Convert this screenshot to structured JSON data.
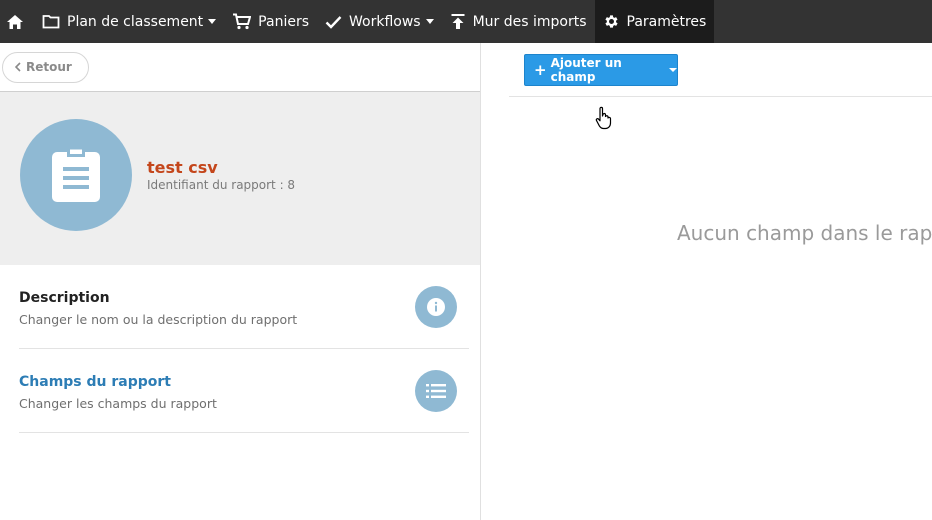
{
  "nav": {
    "home_icon": "home-icon",
    "items": [
      {
        "label": "Plan de classement",
        "icon": "folder-icon",
        "dropdown": true
      },
      {
        "label": "Paniers",
        "icon": "cart-icon",
        "dropdown": false
      },
      {
        "label": "Workflows",
        "icon": "check-icon",
        "dropdown": true
      },
      {
        "label": "Mur des imports",
        "icon": "upload-icon",
        "dropdown": false
      },
      {
        "label": "Paramètres",
        "icon": "gear-icon",
        "dropdown": false,
        "active": true
      }
    ]
  },
  "back": {
    "label": "Retour"
  },
  "report": {
    "title": "test csv",
    "subtitle": "Identifiant du rapport : 8",
    "icon": "clipboard-icon"
  },
  "menu": [
    {
      "title": "Description",
      "desc": "Changer le nom ou la description du rapport",
      "icon": "info-icon"
    },
    {
      "title": "Champs du rapport",
      "desc": "Changer les champs du rapport",
      "icon": "list-icon"
    }
  ],
  "toolbar": {
    "add_label": "Ajouter un champ"
  },
  "empty_message": "Aucun champ dans le rapport",
  "colors": {
    "nav_bg": "#333333",
    "accent_blue": "#2b9ae6",
    "title_orange": "#c4461b",
    "avatar_blue": "#8fb9d3",
    "link_blue": "#2d7db5"
  }
}
